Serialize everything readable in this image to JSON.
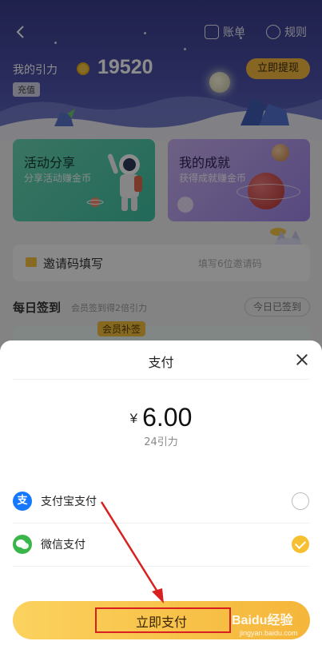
{
  "header": {
    "bill_label": "账单",
    "rules_label": "规则"
  },
  "balance": {
    "label": "我的引力",
    "value": "19520",
    "recharge_tag": "充值",
    "withdraw_label": "立即提现"
  },
  "cards": {
    "activity": {
      "title": "活动分享",
      "subtitle": "分享活动赚金币"
    },
    "achievement": {
      "title": "我的成就",
      "subtitle": "获得成就赚金币"
    }
  },
  "invite": {
    "label": "邀请码填写",
    "placeholder": "填写6位邀请码"
  },
  "daily_sign": {
    "title": "每日签到",
    "subtitle": "会员签到得2倍引力",
    "signed_label": "今日已签到",
    "member_tag": "会员补签"
  },
  "payment_sheet": {
    "title": "支付",
    "currency_symbol": "¥",
    "amount": "6.00",
    "amount_sub": "24引力",
    "methods": [
      {
        "label": "支付宝支付",
        "icon": "alipay-icon",
        "icon_glyph": "支",
        "selected": false
      },
      {
        "label": "微信支付",
        "icon": "wechat-icon",
        "icon_glyph": "✓",
        "selected": true
      }
    ],
    "pay_button_label": "立即支付"
  },
  "watermark": {
    "brand": "Baidu经验",
    "url": "jingyan.baidu.com"
  },
  "colors": {
    "accent": "#f6c032",
    "alipay": "#1677ff",
    "wechat": "#39b54a",
    "annotation": "#d82020"
  }
}
